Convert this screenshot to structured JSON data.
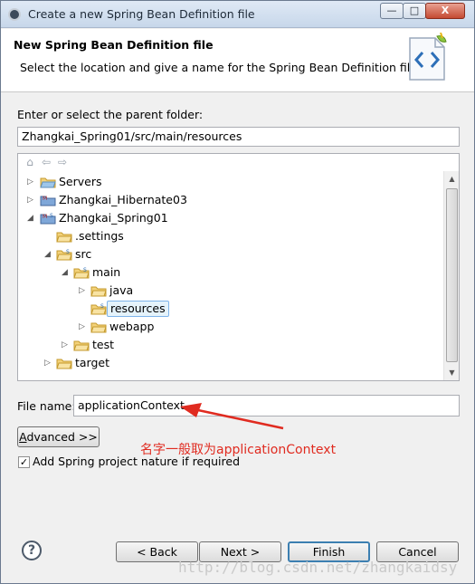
{
  "window": {
    "title": "Create a new Spring Bean Definition file",
    "minimize_symbol": "—",
    "maximize_symbol": "□",
    "close_symbol": "X"
  },
  "header": {
    "title": "New Spring Bean Definition file",
    "description": "Select the location and give a name for the Spring Bean Definition file"
  },
  "folder": {
    "label": "Enter or select the parent folder:",
    "value": "Zhangkai_Spring01/src/main/resources"
  },
  "tree": {
    "toolbar": {
      "home_symbol": "⌂",
      "back_symbol": "⇦",
      "forward_symbol": "⇨"
    },
    "items": [
      {
        "label": "Servers"
      },
      {
        "label": "Zhangkai_Hibernate03"
      },
      {
        "label": "Zhangkai_Spring01"
      },
      {
        "label": ".settings"
      },
      {
        "label": "src"
      },
      {
        "label": "main"
      },
      {
        "label": "java"
      },
      {
        "label": "resources"
      },
      {
        "label": "webapp"
      },
      {
        "label": "test"
      },
      {
        "label": "target"
      }
    ]
  },
  "file_name": {
    "label": "File name:",
    "value": "applicationContext"
  },
  "annotation": {
    "text": "名字一般取为applicationContext",
    "color": "#e02b20"
  },
  "advanced_button": {
    "label_prefix": "A",
    "label_rest": "dvanced >>"
  },
  "checkbox": {
    "label": "Add Spring project nature if required",
    "mark": "✓"
  },
  "footer": {
    "help_symbol": "?",
    "back_button": "< Back",
    "next_button": "Next >",
    "finish_button": "Finish",
    "cancel_button": "Cancel"
  },
  "watermark": "http://blog.csdn.net/zhangkaidsy"
}
